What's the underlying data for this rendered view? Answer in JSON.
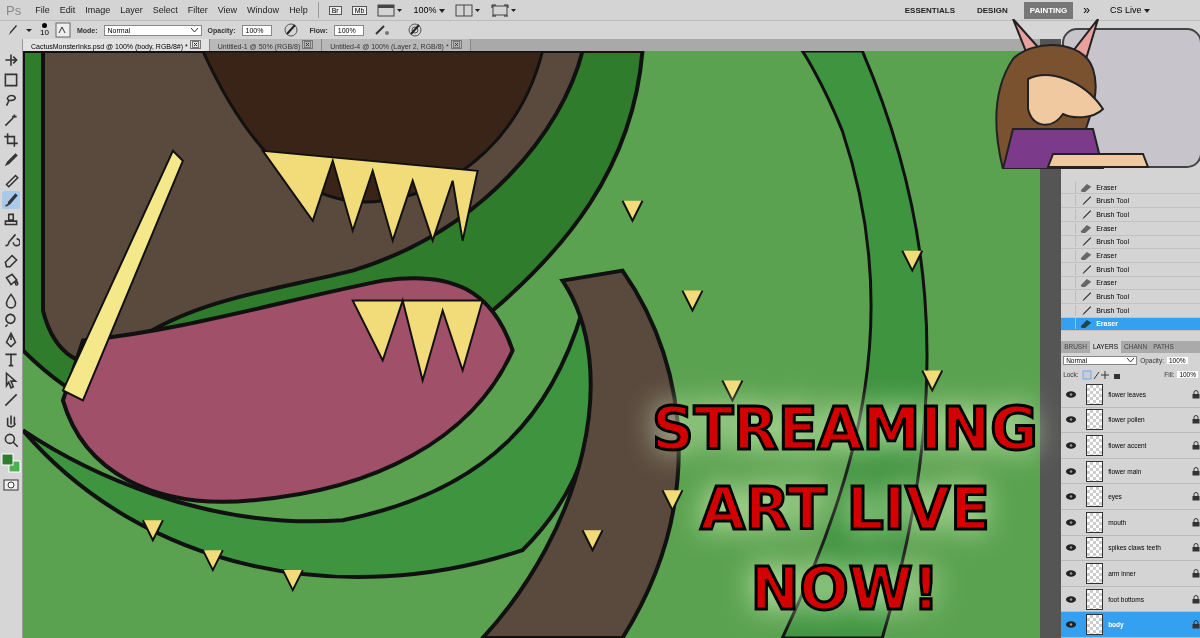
{
  "app": {
    "logo": "Ps"
  },
  "menu": [
    "File",
    "Edit",
    "Image",
    "Layer",
    "Select",
    "Filter",
    "View",
    "Window",
    "Help"
  ],
  "app_bar": {
    "bridge": "Br",
    "mini_bridge": "Mb",
    "zoom": "100%"
  },
  "workspaces": [
    {
      "label": "ESSENTIALS",
      "selected": false
    },
    {
      "label": "DESIGN",
      "selected": false
    },
    {
      "label": "PAINTING",
      "selected": true
    }
  ],
  "more": "»",
  "cs_live": "CS Live",
  "options": {
    "brush_size": "10",
    "mode_label": "Mode:",
    "mode": "Normal",
    "opacity_label": "Opacity:",
    "opacity": "100%",
    "flow_label": "Flow:",
    "flow": "100%"
  },
  "documents": [
    {
      "title": "CactusMonsterInks.psd @ 100% (body, RGB/8#) *",
      "selected": true
    },
    {
      "title": "Untitled-1 @ 50% (RGB/8)",
      "selected": false
    },
    {
      "title": "Untitled-4 @ 100% (Layer 2, RGB/8) *",
      "selected": false
    }
  ],
  "tools": [
    {
      "selected": false
    },
    {
      "selected": false
    },
    {
      "selected": false
    },
    {
      "selected": false
    },
    {
      "selected": false
    },
    {
      "selected": false
    },
    {
      "selected": false
    },
    {
      "selected": true
    },
    {
      "selected": false
    },
    {
      "selected": false
    },
    {
      "selected": false
    },
    {
      "selected": false
    },
    {
      "selected": false
    },
    {
      "selected": false
    },
    {
      "selected": false
    },
    {
      "selected": false
    },
    {
      "selected": false
    },
    {
      "selected": false
    },
    {
      "selected": false
    },
    {
      "selected": false
    }
  ],
  "overlay": {
    "lines": [
      "STREAMING",
      "ART LIVE",
      "NOW!"
    ]
  },
  "history": [
    {
      "label": "Eraser",
      "kind": "eraser",
      "selected": false
    },
    {
      "label": "Brush Tool",
      "kind": "brush",
      "selected": false
    },
    {
      "label": "Brush Tool",
      "kind": "brush",
      "selected": false
    },
    {
      "label": "Eraser",
      "kind": "eraser",
      "selected": false
    },
    {
      "label": "Brush Tool",
      "kind": "brush",
      "selected": false
    },
    {
      "label": "Eraser",
      "kind": "eraser",
      "selected": false
    },
    {
      "label": "Brush Tool",
      "kind": "brush",
      "selected": false
    },
    {
      "label": "Eraser",
      "kind": "eraser",
      "selected": false
    },
    {
      "label": "Brush Tool",
      "kind": "brush",
      "selected": false
    },
    {
      "label": "Brush Tool",
      "kind": "brush",
      "selected": false
    },
    {
      "label": "Eraser",
      "kind": "eraser",
      "selected": true
    }
  ],
  "panel_tabs": [
    {
      "label": "BRUSH",
      "selected": false
    },
    {
      "label": "LAYERS",
      "selected": true
    },
    {
      "label": "CHANN",
      "selected": false
    },
    {
      "label": "PATHS",
      "selected": false
    }
  ],
  "layers_panel": {
    "blend_mode": "Normal",
    "opacity_label": "Opacity:",
    "opacity": "100%",
    "lock_label": "Lock:",
    "fill_label": "Fill:",
    "fill": "100%"
  },
  "layers": [
    {
      "name": "flower leaves",
      "visible": true,
      "selected": false
    },
    {
      "name": "flower pollen",
      "visible": true,
      "selected": false
    },
    {
      "name": "flower accent",
      "visible": true,
      "selected": false
    },
    {
      "name": "flower main",
      "visible": true,
      "selected": false
    },
    {
      "name": "eyes",
      "visible": true,
      "selected": false
    },
    {
      "name": "mouth",
      "visible": true,
      "selected": false
    },
    {
      "name": "spikes claws teeth",
      "visible": true,
      "selected": false
    },
    {
      "name": "arm inner",
      "visible": true,
      "selected": false
    },
    {
      "name": "foot bottoms",
      "visible": true,
      "selected": false
    },
    {
      "name": "body",
      "visible": true,
      "selected": true
    }
  ]
}
